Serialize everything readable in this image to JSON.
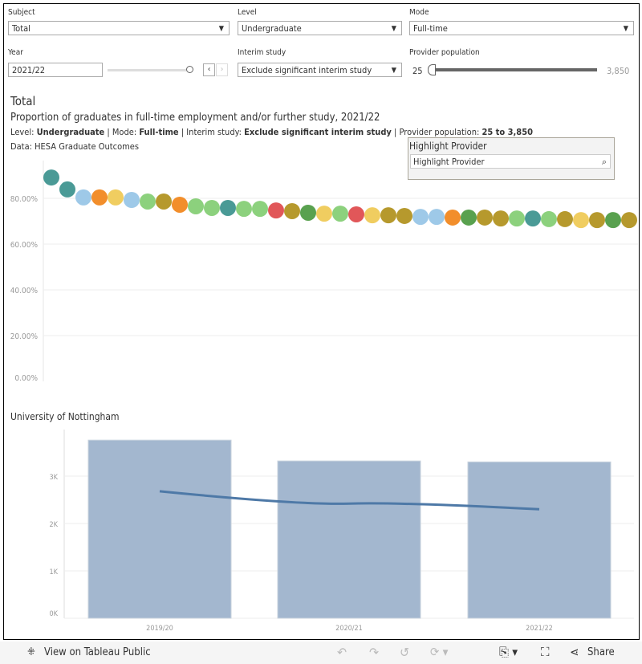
{
  "filters": {
    "subject": {
      "label": "Subject",
      "value": "Total"
    },
    "level": {
      "label": "Level",
      "value": "Undergraduate"
    },
    "mode": {
      "label": "Mode",
      "value": "Full-time"
    },
    "year": {
      "label": "Year",
      "value": "2021/22"
    },
    "interim": {
      "label": "Interim study",
      "value": "Exclude significant interim study"
    },
    "population": {
      "label": "Provider population",
      "min": "25",
      "max": "3,850"
    }
  },
  "header": {
    "title": "Total",
    "subtitle": "Proportion of graduates in full-time employment and/or further study, 2021/22",
    "details": [
      {
        "k": "Level: ",
        "v": "Undergraduate"
      },
      {
        "k": " | Mode: ",
        "v": "Full-time"
      },
      {
        "k": " | Interim study: ",
        "v": "Exclude significant interim study"
      },
      {
        "k": " | Provider population: ",
        "v": "25 to 3,850"
      }
    ],
    "source": "Data: HESA Graduate Outcomes"
  },
  "highlight": {
    "title": "Highlight Provider",
    "placeholder": "Highlight Provider"
  },
  "colors": {
    "teal": "#4a9a96",
    "lightblue": "#9ec9e8",
    "orange": "#f28e2b",
    "yellow": "#f0cd60",
    "lightgreen": "#8cd17d",
    "olive": "#b6992d",
    "red": "#e15759",
    "darkgreen": "#59a14f",
    "bar": "#a3b7cf",
    "line": "#4e79a7"
  },
  "chart_data": [
    {
      "type": "scatter",
      "yticks": [
        "0.00%",
        "20.00%",
        "40.00%",
        "60.00%",
        "80.00%"
      ],
      "ylim": [
        0,
        100
      ],
      "grid": true,
      "values": [
        89.1,
        83.9,
        80.4,
        80.4,
        80.4,
        79.3,
        78.6,
        78.6,
        77.2,
        76.5,
        75.8,
        75.8,
        75.4,
        75.4,
        74.7,
        74.4,
        73.7,
        73.3,
        73.3,
        73.0,
        72.6,
        72.6,
        72.3,
        71.9,
        71.9,
        71.6,
        71.6,
        71.6,
        71.2,
        71.2,
        71.2,
        70.9,
        70.9,
        70.5,
        70.5,
        70.5,
        70.5
      ],
      "point_colors": [
        "teal",
        "teal",
        "lightblue",
        "orange",
        "yellow",
        "lightblue",
        "lightgreen",
        "olive",
        "orange",
        "lightgreen",
        "lightgreen",
        "teal",
        "lightgreen",
        "lightgreen",
        "red",
        "olive",
        "darkgreen",
        "yellow",
        "lightgreen",
        "red",
        "yellow",
        "olive",
        "olive",
        "lightblue",
        "lightblue",
        "orange",
        "darkgreen",
        "olive",
        "olive",
        "lightgreen",
        "teal",
        "lightgreen",
        "olive",
        "yellow",
        "olive",
        "darkgreen",
        "olive"
      ]
    },
    {
      "type": "bar",
      "title": "University of Nottingham",
      "categories": [
        "2019/20",
        "2020/21",
        "2021/22"
      ],
      "series": [
        {
          "type": "bar",
          "values": [
            3760,
            3320,
            3300
          ]
        },
        {
          "type": "line",
          "values": [
            2680,
            2420,
            2300
          ]
        }
      ],
      "yticks": [
        "0K",
        "1K",
        "2K",
        "3K"
      ],
      "ylim": [
        0,
        4000
      ],
      "grid": true
    }
  ],
  "footer": {
    "view_label": "View on Tableau Public",
    "share_label": "Share"
  }
}
